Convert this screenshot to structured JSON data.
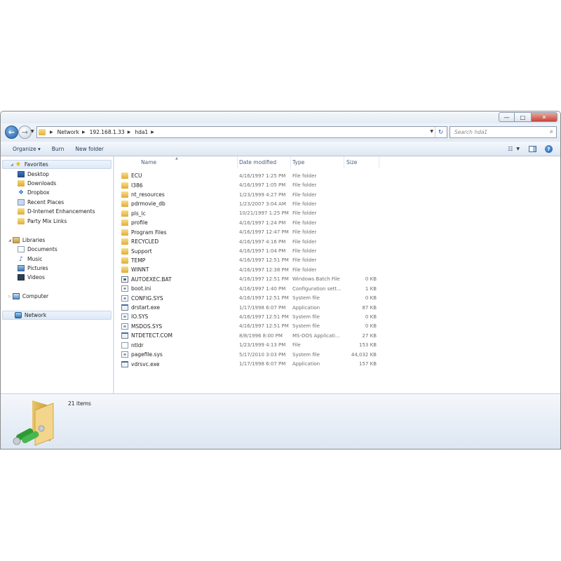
{
  "window": {
    "buttons": {
      "minimize": "—",
      "maximize": "□",
      "close": "✕"
    }
  },
  "navigation": {
    "back_icon": "back-arrow-icon",
    "forward_icon": "forward-arrow-icon",
    "breadcrumbs": [
      "Network",
      "192.168.1.33",
      "hda1"
    ],
    "search_placeholder": "Search hda1"
  },
  "toolbar": {
    "organize_label": "Organize ▾",
    "burn_label": "Burn",
    "new_folder_label": "New folder"
  },
  "sidebar": {
    "favorites": {
      "label": "Favorites",
      "items": [
        {
          "label": "Desktop",
          "icon": "desktop-icon"
        },
        {
          "label": "Downloads",
          "icon": "downloads-icon"
        },
        {
          "label": "Dropbox",
          "icon": "dropbox-icon"
        },
        {
          "label": "Recent Places",
          "icon": "recent-places-icon"
        },
        {
          "label": "D-Internet Enhancements",
          "icon": "folder-icon"
        },
        {
          "label": "Party Mix Links",
          "icon": "folder-icon"
        }
      ]
    },
    "libraries": {
      "label": "Libraries",
      "items": [
        {
          "label": "Documents",
          "icon": "documents-icon"
        },
        {
          "label": "Music",
          "icon": "music-icon"
        },
        {
          "label": "Pictures",
          "icon": "pictures-icon"
        },
        {
          "label": "Videos",
          "icon": "videos-icon"
        }
      ]
    },
    "computer": {
      "label": "Computer"
    },
    "network": {
      "label": "Network"
    }
  },
  "columns": {
    "name": "Name",
    "date": "Date modified",
    "type": "Type",
    "size": "Size"
  },
  "files": [
    {
      "name": "ECU",
      "date": "4/16/1997 1:25 PM",
      "type": "File folder",
      "size": "",
      "icon": "folder"
    },
    {
      "name": "I386",
      "date": "4/16/1997 1:05 PM",
      "type": "File folder",
      "size": "",
      "icon": "folder"
    },
    {
      "name": "nt_resources",
      "date": "1/23/1999 4:27 PM",
      "type": "File folder",
      "size": "",
      "icon": "folder"
    },
    {
      "name": "pdrmovie_db",
      "date": "1/23/2007 3:04 AM",
      "type": "File folder",
      "size": "",
      "icon": "folder"
    },
    {
      "name": "pls_lc",
      "date": "10/21/1997 1:25 PM",
      "type": "File folder",
      "size": "",
      "icon": "folder"
    },
    {
      "name": "profile",
      "date": "4/16/1997 1:24 PM",
      "type": "File folder",
      "size": "",
      "icon": "folder"
    },
    {
      "name": "Program Files",
      "date": "4/16/1997 12:47 PM",
      "type": "File folder",
      "size": "",
      "icon": "folder"
    },
    {
      "name": "RECYCLED",
      "date": "4/16/1997 4:16 PM",
      "type": "File folder",
      "size": "",
      "icon": "folder"
    },
    {
      "name": "Support",
      "date": "4/16/1997 1:04 PM",
      "type": "File folder",
      "size": "",
      "icon": "folder"
    },
    {
      "name": "TEMP",
      "date": "4/16/1997 12:51 PM",
      "type": "File folder",
      "size": "",
      "icon": "folder"
    },
    {
      "name": "WINNT",
      "date": "4/16/1997 12:38 PM",
      "type": "File folder",
      "size": "",
      "icon": "folder"
    },
    {
      "name": "AUTOEXEC.BAT",
      "date": "4/16/1997 12:51 PM",
      "type": "Windows Batch File",
      "size": "0 KB",
      "icon": "bat"
    },
    {
      "name": "boot.ini",
      "date": "4/16/1997 1:40 PM",
      "type": "Configuration sett...",
      "size": "1 KB",
      "icon": "sys"
    },
    {
      "name": "CONFIG.SYS",
      "date": "4/16/1997 12:51 PM",
      "type": "System file",
      "size": "0 KB",
      "icon": "sys"
    },
    {
      "name": "drstart.exe",
      "date": "1/17/1998 6:07 PM",
      "type": "Application",
      "size": "87 KB",
      "icon": "exe"
    },
    {
      "name": "IO.SYS",
      "date": "4/16/1997 12:51 PM",
      "type": "System file",
      "size": "0 KB",
      "icon": "sys"
    },
    {
      "name": "MSDOS.SYS",
      "date": "4/16/1997 12:51 PM",
      "type": "System file",
      "size": "0 KB",
      "icon": "sys"
    },
    {
      "name": "NTDETECT.COM",
      "date": "8/8/1996 8:00 PM",
      "type": "MS-DOS Applicati...",
      "size": "27 KB",
      "icon": "exe"
    },
    {
      "name": "ntldr",
      "date": "1/23/1999 4:13 PM",
      "type": "File",
      "size": "153 KB",
      "icon": "txt"
    },
    {
      "name": "pagefile.sys",
      "date": "5/17/2010 3:03 PM",
      "type": "System file",
      "size": "44,032 KB",
      "icon": "sys"
    },
    {
      "name": "vdrsvc.exe",
      "date": "1/17/1998 6:07 PM",
      "type": "Application",
      "size": "157 KB",
      "icon": "exe"
    }
  ],
  "details": {
    "item_count": "21 items",
    "icon": "network-folder-icon"
  }
}
